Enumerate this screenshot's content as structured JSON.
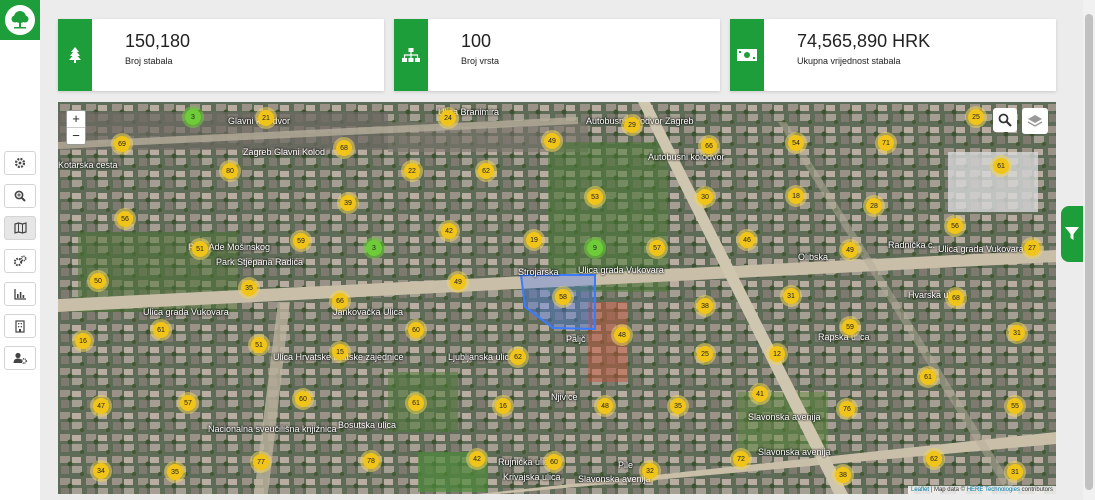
{
  "stats": [
    {
      "value": "150,180",
      "label": "Broj stabala",
      "icon": "tree-icon"
    },
    {
      "value": "100",
      "label": "Broj vrsta",
      "icon": "sitemap-icon"
    },
    {
      "value": "74,565,890 HRK",
      "label": "Ukupna vrijednost stabala",
      "icon": "money-icon"
    }
  ],
  "sidebar": {
    "items": [
      "settings-icon",
      "search-plus-icon",
      "map-icon",
      "cogs-icon",
      "chart-icon",
      "building-icon",
      "user-settings-icon"
    ]
  },
  "map": {
    "zoom_in": "+",
    "zoom_out": "−",
    "streets": [
      "Ulica grada Vukovara",
      "Ulica grada Vukovara",
      "Ulica grada Vukovara",
      "Glavni kolodvor",
      "Zagreb Glavni Kolod",
      "Ulica Branimira",
      "Kotarska cesta",
      "Autobusni kolodvor Zagreb",
      "Autobusni kolodvor",
      "Strojarska",
      "Jankovačka Ulica",
      "Slavonska avenija",
      "Slavonska avenija",
      "Slavonska avenija",
      "Olibska",
      "Radnička c.",
      "Park Ade Mošinskog",
      "Park Stjepana Radića",
      "Hvarska ulica",
      "Rapska ulica",
      "Njivice",
      "Rujnička ulica",
      "Krivajska ulica",
      "Bosutska ulica",
      "Nacionalna sveučilišna knjižnica",
      "Pile",
      "Ljubljanska ulica",
      "Paljč",
      "Ulica Hrvatske bratske zajednice"
    ],
    "clusters": [
      {
        "n": "3",
        "green": true
      },
      {
        "n": "21"
      },
      {
        "n": "24"
      },
      {
        "n": "29"
      },
      {
        "n": "25"
      },
      {
        "n": "69"
      },
      {
        "n": "68"
      },
      {
        "n": "49"
      },
      {
        "n": "66"
      },
      {
        "n": "54"
      },
      {
        "n": "71"
      },
      {
        "n": "80"
      },
      {
        "n": "22"
      },
      {
        "n": "62"
      },
      {
        "n": "61"
      },
      {
        "n": "39"
      },
      {
        "n": "53"
      },
      {
        "n": "30"
      },
      {
        "n": "18"
      },
      {
        "n": "28"
      },
      {
        "n": "56"
      },
      {
        "n": "42"
      },
      {
        "n": "46"
      },
      {
        "n": "56"
      },
      {
        "n": "51"
      },
      {
        "n": "59"
      },
      {
        "n": "3",
        "green": true
      },
      {
        "n": "19"
      },
      {
        "n": "9",
        "green": true
      },
      {
        "n": "57"
      },
      {
        "n": "49"
      },
      {
        "n": "27"
      },
      {
        "n": "50"
      },
      {
        "n": "35"
      },
      {
        "n": "49"
      },
      {
        "n": "31"
      },
      {
        "n": "68"
      },
      {
        "n": "66"
      },
      {
        "n": "58"
      },
      {
        "n": "38"
      },
      {
        "n": "61"
      },
      {
        "n": "60"
      },
      {
        "n": "48"
      },
      {
        "n": "59"
      },
      {
        "n": "16"
      },
      {
        "n": "51"
      },
      {
        "n": "15"
      },
      {
        "n": "62"
      },
      {
        "n": "25"
      },
      {
        "n": "12"
      },
      {
        "n": "31"
      },
      {
        "n": "47"
      },
      {
        "n": "57"
      },
      {
        "n": "60"
      },
      {
        "n": "61"
      },
      {
        "n": "16"
      },
      {
        "n": "48"
      },
      {
        "n": "35"
      },
      {
        "n": "41"
      },
      {
        "n": "76"
      },
      {
        "n": "61"
      },
      {
        "n": "55"
      },
      {
        "n": "34"
      },
      {
        "n": "35"
      },
      {
        "n": "77"
      },
      {
        "n": "78"
      },
      {
        "n": "42"
      },
      {
        "n": "60"
      },
      {
        "n": "32"
      },
      {
        "n": "72"
      },
      {
        "n": "38"
      },
      {
        "n": "62"
      },
      {
        "n": "31"
      }
    ],
    "attribution": {
      "leaflet": "Leaflet",
      "sep": " | Map data © ",
      "here": "HERE Technologies",
      "rest": " contributors"
    }
  },
  "colors": {
    "brand": "#1e9e3a",
    "cluster": "#f0c419",
    "cluster_green": "#6ecc39"
  }
}
